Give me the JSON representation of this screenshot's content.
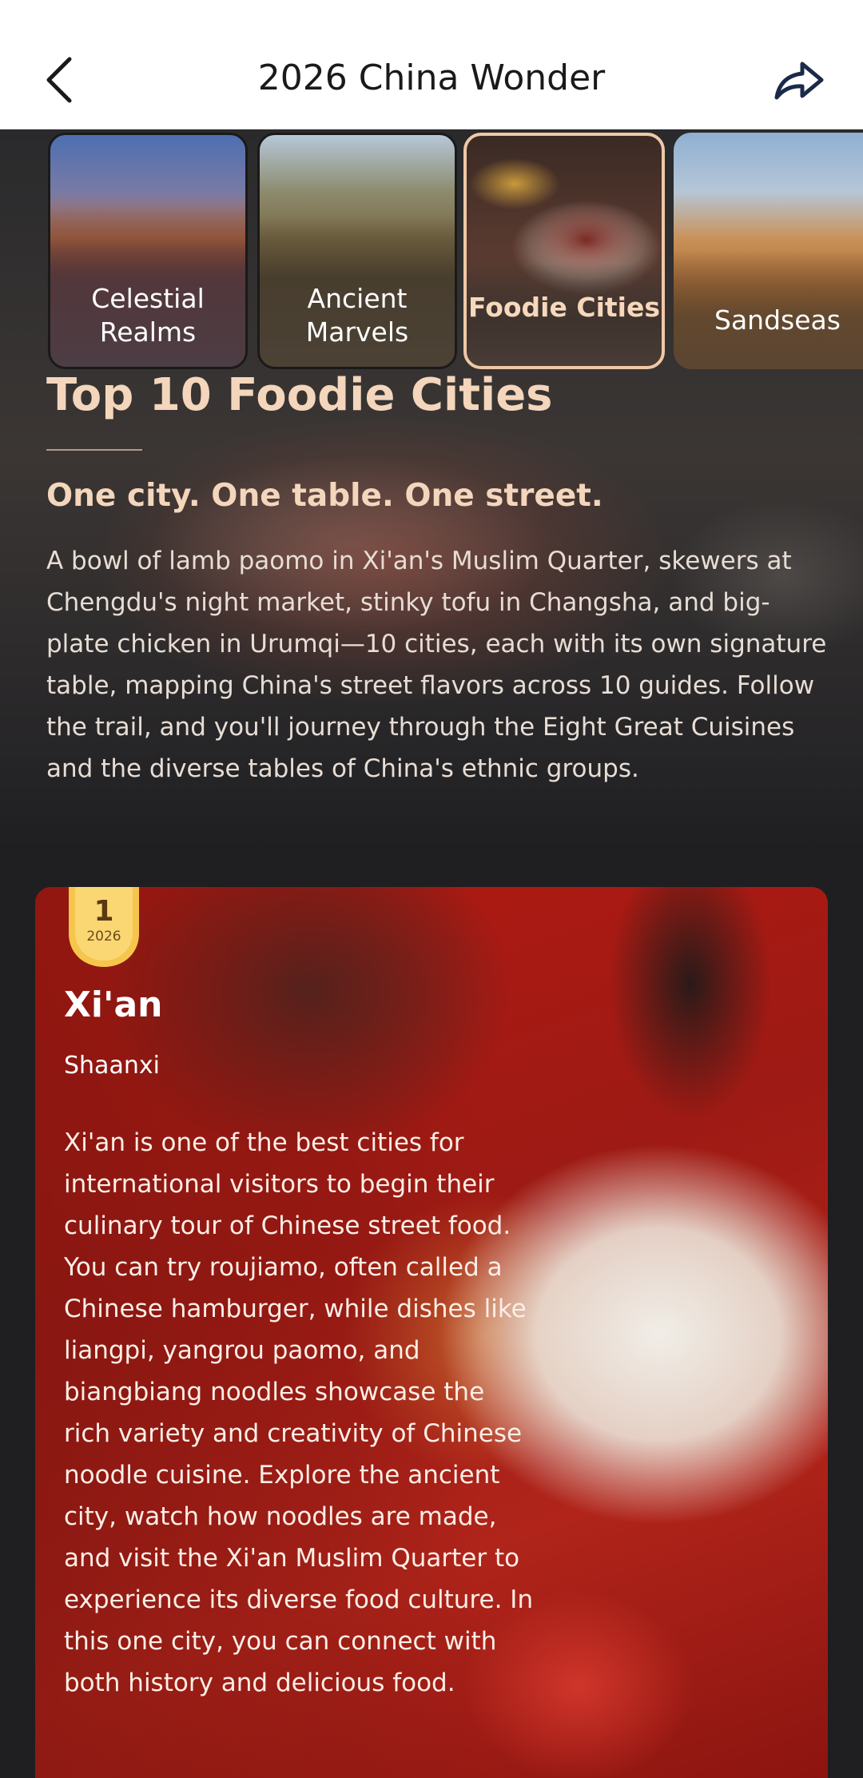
{
  "header": {
    "title": "2026 China Wonder",
    "back_icon": "chevron-left-icon",
    "share_icon": "share-arrow-icon"
  },
  "tabs": [
    {
      "label": "Celestial\nRealms",
      "selected": false
    },
    {
      "label": "Ancient\nMarvels",
      "selected": false
    },
    {
      "label": "Foodie Cities",
      "selected": true
    },
    {
      "label": "Sandseas",
      "selected": false
    }
  ],
  "section": {
    "title": "Top 10 Foodie Cities",
    "subtitle": "One city. One table. One street.",
    "body": "A bowl of lamb paomo in Xi'an's Muslim Quarter, skewers at Chengdu's night market, stinky tofu in Changsha, and big-plate chicken in Urumqi—10 cities, each with its own signature table, mapping China's street flavors across 10 guides. Follow the trail, and you'll journey through the Eight Great Cuisines and the diverse tables of China's ethnic groups."
  },
  "card": {
    "rank": "1",
    "rank_year": "2026",
    "city": "Xi'an",
    "province": "Shaanxi",
    "description": "Xi'an is one of the best cities for international visitors to begin their culinary tour of Chinese street food. You can try roujiamo, often called a Chinese hamburger, while dishes like liangpi, yangrou paomo, and biangbiang noodles showcase the rich variety and creativity of Chinese noodle cuisine. Explore the ancient city, watch how noodles are made, and visit the Xi'an Muslim Quarter to experience its diverse food culture. In this one city, you can connect with both history and delicious food."
  },
  "colors": {
    "accent": "#f3d6bc",
    "selected_tab_border": "#f0c8a6",
    "card_red": "#b11a12",
    "badge_gold": "#f4c24a"
  }
}
